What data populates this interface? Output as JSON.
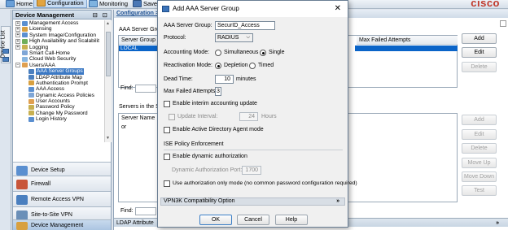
{
  "toolbar": {
    "home": "Home",
    "configuration": "Configuration",
    "monitoring": "Monitoring",
    "save": "Save",
    "logo": "cisco"
  },
  "side_tab": {
    "label": "Device List"
  },
  "device_panel": {
    "title": "Device Management",
    "tree": [
      "Management Access",
      "Licensing",
      "System Image/Configuration",
      "High Availability and Scalabilit",
      "Logging",
      "Smart Call-Home",
      "Cloud Web Security",
      "Users/AAA",
      "AAA Server Groups",
      "LDAP Attribute Map",
      "Authentication Prompt",
      "AAA Access",
      "Dynamic Access Policies",
      "User Accounts",
      "Password Policy",
      "Change My Password",
      "Login History"
    ],
    "nav": [
      "Device Setup",
      "Firewall",
      "Remote Access VPN",
      "Site-to-Site VPN",
      "Device Management"
    ]
  },
  "main": {
    "breadcrumb": "Configuration >",
    "aaa_groups_label": "AAA Server Grou",
    "col_server_group": "Server Group",
    "col_max_failed": "Max Failed Attempts",
    "row_local": "LOCAL",
    "find_label": "Find:",
    "servers_label": "Servers in the Se",
    "col_server_name": "Server Name or",
    "buttons_top": [
      "Add",
      "Edit",
      "Delete"
    ],
    "buttons_bottom": [
      "Add",
      "Edit",
      "Delete",
      "Move Up",
      "Move Down",
      "Test"
    ],
    "ldap_bar": "LDAP Attribute"
  },
  "dialog": {
    "title": "Add AAA Server Group",
    "group_label": "AAA Server Group:",
    "group_value": "SecurID_Access",
    "protocol_label": "Protocol:",
    "protocol_value": "RADIUS",
    "accounting_label": "Accounting Mode:",
    "acc_simultaneous": "Simultaneous",
    "acc_single": "Single",
    "reactivation_label": "Reactivation Mode:",
    "react_depletion": "Depletion",
    "react_timed": "Timed",
    "dead_time_label": "Dead Time:",
    "dead_time_value": "10",
    "minutes": "minutes",
    "max_failed_label": "Max Failed Attempts:",
    "max_failed_value": "3",
    "interim_label": "Enable interim accounting update",
    "update_interval_label": "Update Interval:",
    "update_interval_value": "24",
    "hours": "Hours",
    "ad_agent_label": "Enable Active Directory Agent mode",
    "ise_section": "ISE Policy Enforcement",
    "dyn_auth_label": "Enable dynamic authorization",
    "dyn_port_label": "Dynamic Authorization Port:",
    "dyn_port_value": "1700",
    "auth_only_label": "Use authorization only mode (no common password configuration required)",
    "vpn3k_label": "VPN3K Compatibility Option",
    "ok": "OK",
    "cancel": "Cancel",
    "help": "Help"
  },
  "colors": {
    "accent": "#0a64c8",
    "selection": "#3c79c4",
    "logo": "#c0392b"
  }
}
